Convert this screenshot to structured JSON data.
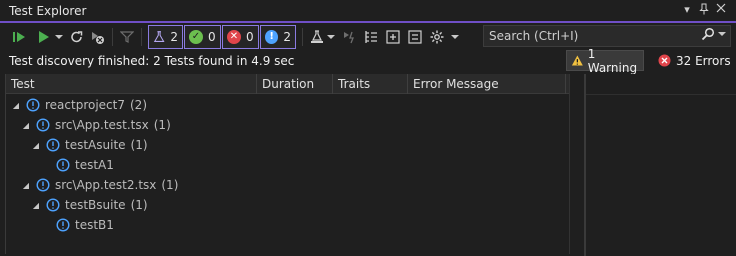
{
  "window": {
    "title": "Test Explorer"
  },
  "toolbar": {
    "counters": [
      {
        "name": "total",
        "count": "2",
        "icon": "flask-icon",
        "color": "#b4a7f0"
      },
      {
        "name": "passed",
        "count": "0",
        "icon": "check-icon",
        "color": "#6cbf4f"
      },
      {
        "name": "failed",
        "count": "0",
        "icon": "x-icon",
        "color": "#e0454b"
      },
      {
        "name": "not-run",
        "count": "2",
        "icon": "info-icon",
        "color": "#4ea3ff"
      }
    ]
  },
  "search": {
    "placeholder": "Search (Ctrl+I)"
  },
  "status": {
    "message": "Test discovery finished: 2 Tests found in 4.9 sec",
    "warnings": "1 Warning",
    "errors": "32 Errors"
  },
  "grid": {
    "columns": [
      "Test",
      "Duration",
      "Traits",
      "Error Message"
    ],
    "rows": [
      {
        "label": "reactproject7",
        "count": "(2)",
        "level": 0,
        "expandable": true
      },
      {
        "label": "src\\App.test.tsx",
        "count": "(1)",
        "level": 1,
        "expandable": true
      },
      {
        "label": "testAsuite",
        "count": "(1)",
        "level": 2,
        "expandable": true
      },
      {
        "label": "testA1",
        "count": "",
        "level": 3,
        "expandable": false
      },
      {
        "label": "src\\App.test2.tsx",
        "count": "(1)",
        "level": 1,
        "expandable": true
      },
      {
        "label": "testBsuite",
        "count": "(1)",
        "level": 2,
        "expandable": true
      },
      {
        "label": "testB1",
        "count": "",
        "level": 3,
        "expandable": false
      }
    ]
  },
  "colors": {
    "accent": "#6f4fc7",
    "info": "#4ea3ff",
    "warning": "#f0c040",
    "error": "#e0454b",
    "run": "#4caf50"
  }
}
